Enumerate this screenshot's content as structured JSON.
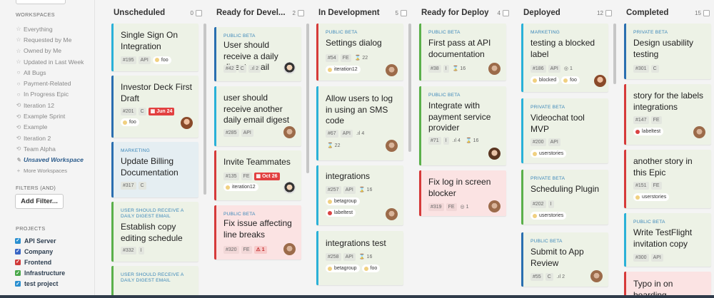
{
  "sidebar": {
    "workspaces_heading": "WORKSPACES",
    "workspaces": [
      {
        "icon": "star-icon",
        "glyph": "☆",
        "label": "Everything"
      },
      {
        "icon": "star-icon",
        "glyph": "☆",
        "label": "Requested by Me"
      },
      {
        "icon": "star-icon",
        "glyph": "☆",
        "label": "Owned by Me"
      },
      {
        "icon": "star-icon",
        "glyph": "☆",
        "label": "Updated in Last Week"
      },
      {
        "icon": "circle-icon",
        "glyph": "○",
        "label": "All Bugs"
      },
      {
        "icon": "circle-icon",
        "glyph": "○",
        "label": "Payment-Related"
      },
      {
        "icon": "circle-icon",
        "glyph": "○",
        "label": "In Progress Epic"
      },
      {
        "icon": "sync-icon",
        "glyph": "⟲",
        "label": "Iteration 12"
      },
      {
        "icon": "sync-icon",
        "glyph": "⟲",
        "label": "Example Sprint"
      },
      {
        "icon": "sync-icon",
        "glyph": "⟲",
        "label": "Example"
      },
      {
        "icon": "sync-icon",
        "glyph": "⟲",
        "label": "Iteration 2"
      },
      {
        "icon": "sync-icon",
        "glyph": "⟲",
        "label": "Team Alpha"
      },
      {
        "icon": "pencil-icon",
        "glyph": "✎",
        "label": "Unsaved Workspace"
      },
      {
        "icon": "plus-icon",
        "glyph": "+",
        "label": "More Workspaces"
      }
    ],
    "filters_heading": "FILTERS (AND)",
    "add_filter_label": "Add Filter...",
    "projects_heading": "PROJECTS",
    "projects": [
      {
        "label": "API Server",
        "color": "#2a8fd0"
      },
      {
        "label": "Company",
        "color": "#3a66c4"
      },
      {
        "label": "Frontend",
        "color": "#d03a3a"
      },
      {
        "label": "Infrastructure",
        "color": "#4aa84a"
      },
      {
        "label": "test project",
        "color": "#2a8fd0"
      }
    ]
  },
  "columns": [
    {
      "title": "Unscheduled",
      "count": "0"
    },
    {
      "title": "Ready for Devel...",
      "count": "2"
    },
    {
      "title": "In Development",
      "count": "5"
    },
    {
      "title": "Ready for Deploy",
      "count": "4"
    },
    {
      "title": "Deployed",
      "count": "12"
    },
    {
      "title": "Completed",
      "count": "15"
    }
  ],
  "cards": {
    "c1a": {
      "title": "Single Sign On Integration",
      "id": "#195",
      "type": "API",
      "labels": [
        "foo"
      ]
    },
    "c1b": {
      "title": "Investor Deck First Draft",
      "id": "#201",
      "type": "C",
      "due": "Jun 24",
      "labels": [
        "foo"
      ]
    },
    "c1c": {
      "epic": "MARKETING",
      "title": "Update Billing Documentation",
      "id": "#317",
      "type": "C"
    },
    "c1d": {
      "epic": "USER SHOULD RECEIVE A DAILY DIGEST EMAIL",
      "title": "Establish copy editing schedule",
      "id": "#332",
      "type": "I"
    },
    "c1e": {
      "epic": "USER SHOULD RECEIVE A DAILY DIGEST EMAIL"
    },
    "c2a": {
      "epic": "PUBLIC BETA",
      "title": "User should receive a daily digest email",
      "id": "#42",
      "type": "C",
      "est": "2"
    },
    "c2b": {
      "title": "user should receive another daily email digest",
      "id": "#285",
      "type": "API"
    },
    "c2c": {
      "title": "Invite Teammates",
      "id": "#135",
      "type": "FE",
      "due": "Oct 26",
      "labels": [
        "iteration12"
      ]
    },
    "c2d": {
      "epic": "PUBLIC BETA",
      "title": "Fix issue affecting line breaks",
      "id": "#320",
      "type": "FE",
      "warn": "1"
    },
    "c3a": {
      "epic": "PUBLIC BETA",
      "title": "Settings dialog",
      "id": "#54",
      "type": "FE",
      "tasks": "22",
      "labels": [
        "iteration12"
      ]
    },
    "c3b": {
      "title": "Allow users to log in using an SMS code",
      "id": "#67",
      "type": "API",
      "est": "4",
      "tasks": "22"
    },
    "c3c": {
      "title": "integrations",
      "id": "#257",
      "type": "API",
      "tasks": "16",
      "labels": [
        "betagroup",
        "labeltest"
      ]
    },
    "c3d": {
      "title": "integrations test",
      "id": "#258",
      "type": "API",
      "tasks": "16",
      "labels": [
        "betagroup",
        "foo"
      ]
    },
    "c4a": {
      "epic": "PUBLIC BETA",
      "title": "First pass at API documentation",
      "id": "#38",
      "type": "I",
      "tasks": "16"
    },
    "c4b": {
      "epic": "PUBLIC BETA",
      "title": "Integrate with payment service provider",
      "id": "#71",
      "type": "I",
      "est": "4",
      "tasks": "16"
    },
    "c4c": {
      "title": "Fix log in screen blocker",
      "id": "#319",
      "type": "FE",
      "comments": "1"
    },
    "c5a": {
      "epic": "MARKETING",
      "title": "testing a blocked label",
      "id": "#186",
      "type": "API",
      "comments": "1",
      "labels": [
        "blocked",
        "foo"
      ]
    },
    "c5b": {
      "epic": "PRIVATE BETA",
      "title": "Videochat tool MVP",
      "id": "#200",
      "type": "API",
      "labels": [
        "userstories"
      ]
    },
    "c5c": {
      "epic": "PRIVATE BETA",
      "title": "Scheduling Plugin",
      "id": "#202",
      "type": "I",
      "labels": [
        "userstories"
      ]
    },
    "c5d": {
      "epic": "PUBLIC BETA",
      "title": "Submit to App Review",
      "id": "#55",
      "type": "C",
      "est": "2"
    },
    "c6a": {
      "epic": "PRIVATE BETA",
      "title": "Design usability testing",
      "id": "#301",
      "type": "C"
    },
    "c6b": {
      "title": "story for the labels integrations",
      "id": "#147",
      "type": "FE",
      "labels": [
        "labeltest"
      ]
    },
    "c6c": {
      "title": "another story in this Epic",
      "id": "#151",
      "type": "FE",
      "labels": [
        "userstories"
      ]
    },
    "c6d": {
      "epic": "PUBLIC BETA",
      "title": "Write TestFlight invitation copy",
      "id": "#300",
      "type": "API"
    },
    "c6e": {
      "title": "Typo in on boarding"
    }
  },
  "colors": {
    "feature_stripe": "#2ab1d8",
    "chore_stripe": "#2a6fb0",
    "bug_stripe": "#d63a3a",
    "green_stripe": "#5bb04a",
    "accent_link": "#3b87b9",
    "label_foo": "#f0d080",
    "label_red": "#d94343"
  }
}
